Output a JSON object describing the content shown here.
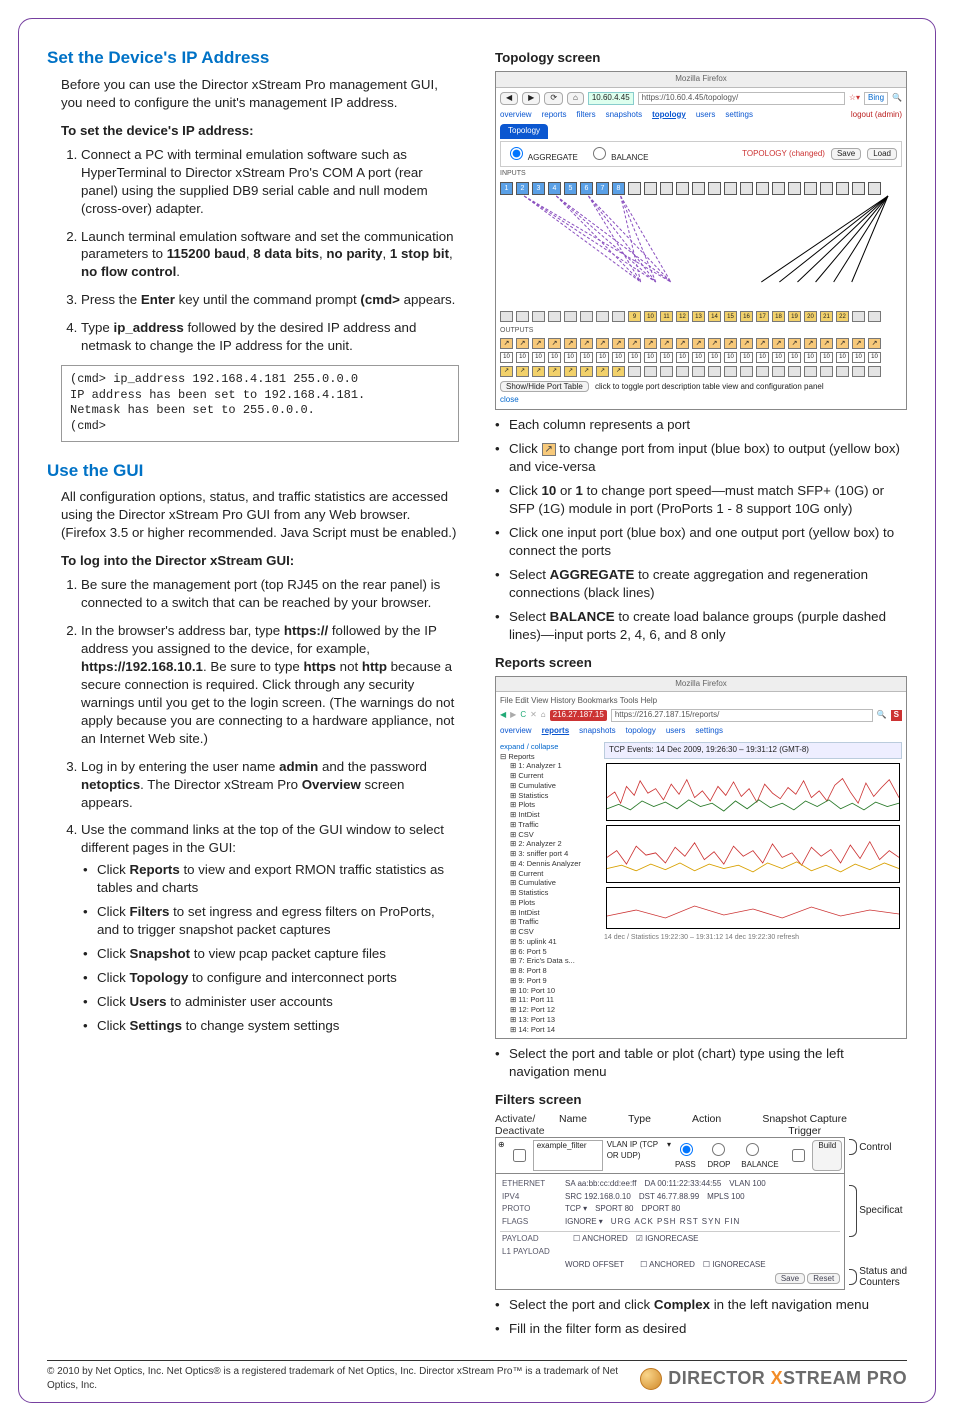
{
  "left": {
    "sec1_title": "Set the Device's IP Address",
    "sec1_intro": "Before you can use the Director xStream Pro management GUI, you need to configure the unit's management IP address.",
    "sec1_subhead": "To set the device's IP address:",
    "sec1_steps": {
      "s1_a": "Connect a PC with terminal emulation software such as HyperTerminal to Director xStream Pro's COM A port (rear panel) using the supplied DB9 serial cable and null modem (cross-over) adapter.",
      "s2_a": "Launch terminal emulation software and set the communication parameters to ",
      "s2_b": "115200 baud",
      "s2_c": ", ",
      "s2_d": "8 data bits",
      "s2_e": ", ",
      "s2_f": "no parity",
      "s2_g": ", ",
      "s2_h": "1 stop bit",
      "s2_i": ", ",
      "s2_j": "no flow control",
      "s2_k": ".",
      "s3_a": "Press the ",
      "s3_b": "Enter",
      "s3_c": " key until the command prompt ",
      "s3_d": "(cmd>",
      "s3_e": " appears.",
      "s4_a": "Type ",
      "s4_b": "ip_address",
      "s4_c": " followed by the desired IP address and netmask to change the IP address for the unit."
    },
    "terminal": "(cmd> ip_address 192.168.4.181 255.0.0.0\nIP address has been set to 192.168.4.181.\nNetmask has been set to 255.0.0.0.\n(cmd>",
    "sec2_title": "Use the GUI",
    "sec2_intro": "All configuration options, status, and traffic statistics are accessed using the Director xStream Pro GUI from any Web browser. (Firefox 3.5 or higher recommended. Java Script must be enabled.)",
    "sec2_subhead": "To log into the Director xStream GUI:",
    "sec2_steps": {
      "s1": "Be sure the management port (top RJ45 on the rear panel) is connected to a switch that can be reached by your browser.",
      "s2_a": "In the browser's address bar, type ",
      "s2_b": "https://",
      "s2_c": " followed by the IP address you assigned to the device, for example, ",
      "s2_d": "https://192.168.10.1",
      "s2_e": ". Be sure to type ",
      "s2_f": "https",
      "s2_g": " not ",
      "s2_h": "http",
      "s2_i": " because a secure connection is required. Click through any security warnings until you get to the login screen. (The warnings do not apply because you are connecting to a hardware appliance, not an Internet Web site.)",
      "s3_a": "Log in by entering the user name ",
      "s3_b": "admin",
      "s3_c": " and the password ",
      "s3_d": "netoptics",
      "s3_e": ". The Director xStream Pro ",
      "s3_f": "Overview",
      "s3_g": " screen appears.",
      "s4": "Use the command links at the top of the GUI window to select different pages in the GUI:"
    },
    "clicks": {
      "c1_a": "Click ",
      "c1_b": "Reports",
      "c1_c": " to view and export RMON traffic statistics as tables and charts",
      "c2_a": "Click ",
      "c2_b": "Filters",
      "c2_c": " to set ingress and egress filters on ProPorts, and to trigger snapshot packet captures",
      "c3_a": "Click ",
      "c3_b": "Snapshot",
      "c3_c": " to view pcap packet capture files",
      "c4_a": "Click ",
      "c4_b": "Topology",
      "c4_c": " to configure and interconnect ports",
      "c5_a": "Click ",
      "c5_b": "Users",
      "c5_c": " to administer user accounts",
      "c6_a": "Click ",
      "c6_b": "Settings",
      "c6_c": " to change system settings"
    }
  },
  "right": {
    "topo_head": "Topology screen",
    "topo_shot": {
      "browser_title": "Mozilla Firefox",
      "url_short": "10.60.4.45",
      "url_full": "https://10.60.4.45/topology/",
      "search": "Bing",
      "tabs": [
        "overview",
        "reports",
        "filters",
        "snapshots",
        "topology",
        "users",
        "settings"
      ],
      "logout": "logout (admin)",
      "ribbon": "Topology",
      "mode_aggregate": "AGGREGATE",
      "mode_balance": "BALANCE",
      "topo_status": "TOPOLOGY (changed)",
      "save": "Save",
      "load": "Load",
      "inputs_label": "INPUTS",
      "outputs_label": "OUTPUTS",
      "show_hide_btn": "Show/Hide Port Table",
      "show_hide_hint": "click to toggle port description table view and configuration panel",
      "close": "close"
    },
    "topo_bullets": {
      "b1": "Each column represents a port",
      "b2_a": "Click ",
      "b2_b": " to change port from input (blue box) to output (yellow box) and vice-versa",
      "b3_a": "Click ",
      "b3_b": "10",
      "b3_c": " or ",
      "b3_d": "1",
      "b3_e": " to change port speed—must match SFP+ (10G) or SFP (1G) module in port (ProPorts 1 - 8 support 10G only)",
      "b4": "Click one input port (blue box) and one output port (yellow box) to connect the ports",
      "b5_a": "Select ",
      "b5_b": "AGGREGATE",
      "b5_c": " to create aggregation and regeneration connections (black lines)",
      "b6_a": "Select ",
      "b6_b": "BALANCE",
      "b6_c": " to create load balance groups (purple dashed lines)—input ports 2, 4, 6, and 8 only"
    },
    "rep_head": "Reports screen",
    "rep_shot": {
      "browser_title": "Mozilla Firefox",
      "menu": "File  Edit  View  History  Bookmarks  Tools  Help",
      "url_host": "216.27.187.15",
      "url": "https://216.27.187.15/reports/",
      "tabs": [
        "overview",
        "reports",
        "snapshots",
        "topology",
        "users",
        "settings"
      ],
      "plot_title": "TCP Events: 14 Dec 2009, 19:26:30 – 19:31:12 (GMT-8)",
      "tree_root": "expand / collapse",
      "tree_reports": "Reports",
      "tree_nodes": [
        "1: Analyzer 1",
        "Current",
        "Cumulative",
        "Statistics",
        "Plots",
        "  IntDist",
        "  Traffic",
        "CSV",
        "2: Analyzer 2",
        "3: sniffer port 4",
        "4: Dennis Analyzer",
        "Current",
        "Cumulative",
        "Statistics",
        "Plots",
        "  IntDist",
        "  Traffic",
        "CSV",
        "5: uplink 41",
        "6: Port 5",
        "7: Eric's Data s...",
        "8: Port 8",
        "9: Port 9",
        "10: Port 10",
        "11: Port 11",
        "12: Port 12",
        "13: Port 13",
        "14: Port 14"
      ],
      "footer_hint": "14 dec / Statistics 19:22:30 – 19:31:12  14 dec  19:22:30  refresh"
    },
    "rep_bullets": {
      "b1": "Select the port and table or plot (chart) type using the left navigation menu"
    },
    "filt_head": "Filters screen",
    "filt_labels_top": {
      "act": "Activate/\nDeactivate",
      "name": "Name",
      "type": "Type",
      "action": "Action",
      "snap": "Snapshot Capture\nTrigger"
    },
    "filt_shot": {
      "name_field": "example_filter",
      "type_field": "VLAN IP (TCP OR UDP)",
      "actions": [
        "PASS",
        "DROP",
        "BALANCE"
      ],
      "build": "Build",
      "rows_ethernet": "ETHERNET",
      "rows_sa": "SA  aa:bb:cc:dd:ee:ff",
      "rows_da": "DA  00:11:22:33:44:55",
      "rows_vlan": "VLAN  100",
      "rows_ipv4": "IPv4",
      "rows_src": "SRC  192.168.0.10",
      "rows_dst": "DST  46.77.88.99",
      "rows_mpls": "MPLS  100",
      "rows_proto": "PROTO",
      "rows_tcp": "TCP ▾",
      "rows_sport": "SPORT  80",
      "rows_dport": "DPORT  80",
      "rows_flags": "FLAGS",
      "rows_ignore": "IGNORE ▾",
      "flag_list": "URG   ACK   PSH   RST   SYN   FIN",
      "payload": "PAYLOAD",
      "l1l2": "L1 Payload",
      "anch": "ANCHORED",
      "ign": "IGNORECASE",
      "wo": "WORD OFFSET",
      "save": "Save",
      "reset": "Reset"
    },
    "filt_right_labels": {
      "control": "Control",
      "spec": "Specificat",
      "status": "Status and\nCounters"
    },
    "filt_bullets": {
      "b1_a": "Select the port and click ",
      "b1_b": "Complex",
      "b1_c": " in the left navigation menu",
      "b2": "Fill in the filter form as desired"
    }
  },
  "footer": {
    "text": "© 2010 by Net Optics, Inc. Net Optics® is a registered trademark of Net Optics, Inc. Director xStream Pro™ is a trademark of Net Optics, Inc.",
    "logo_a": "DIRECTOR ",
    "logo_x": "X",
    "logo_b": "STREAM PRO"
  }
}
